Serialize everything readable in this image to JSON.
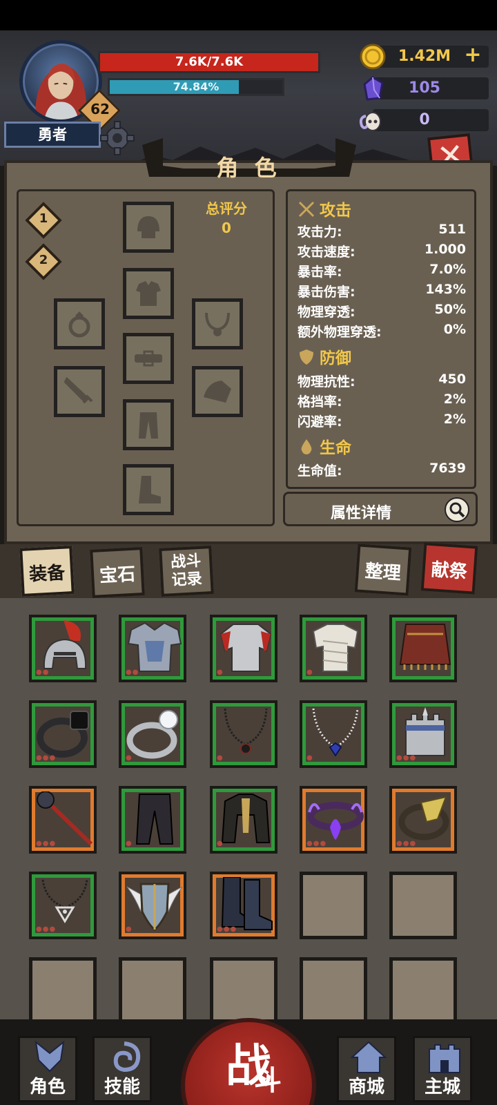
{
  "player": {
    "level": "62",
    "name": "勇者",
    "hp": "7.6K/7.6K",
    "xp_percent_text": "74.84%",
    "xp_fraction": 0.7484
  },
  "currencies": {
    "gold": "1.42M",
    "gems": "105",
    "ram_tokens": "0",
    "gold_color": "#f2c84a",
    "gems_color": "#9e89e8",
    "ram_color": "#c9b9f4"
  },
  "panel": {
    "title": "角 色",
    "presets": [
      "1",
      "2"
    ],
    "score_label": "总评分",
    "score_value": "0"
  },
  "stats": {
    "attack": {
      "title": "攻击",
      "rows": [
        {
          "k": "攻击力:",
          "v": "511"
        },
        {
          "k": "攻击速度:",
          "v": "1.000"
        },
        {
          "k": "暴击率:",
          "v": "7.0%"
        },
        {
          "k": "暴击伤害:",
          "v": "143%"
        },
        {
          "k": "物理穿透:",
          "v": "50%"
        },
        {
          "k": "额外物理穿透:",
          "v": "0%"
        }
      ]
    },
    "defense": {
      "title": "防御",
      "rows": [
        {
          "k": "物理抗性:",
          "v": "450"
        },
        {
          "k": "格挡率:",
          "v": "2%"
        },
        {
          "k": "闪避率:",
          "v": "2%"
        }
      ]
    },
    "life": {
      "title": "生命",
      "rows": [
        {
          "k": "生命值:",
          "v": "7639"
        }
      ]
    },
    "details_button": "属性详情"
  },
  "inventory_tabs": {
    "equipment": "装备",
    "gems": "宝石",
    "battle_log_1": "战斗",
    "battle_log_2": "记录",
    "sort": "整理",
    "sacrifice": "献祭"
  },
  "rarity_colors": {
    "green": "#2f9a3c",
    "orange": "#e07b2e"
  },
  "nav": {
    "character": "角色",
    "skills": "技能",
    "battle_1": "战",
    "battle_2": "斗",
    "shop": "商城",
    "main_city": "主城"
  }
}
